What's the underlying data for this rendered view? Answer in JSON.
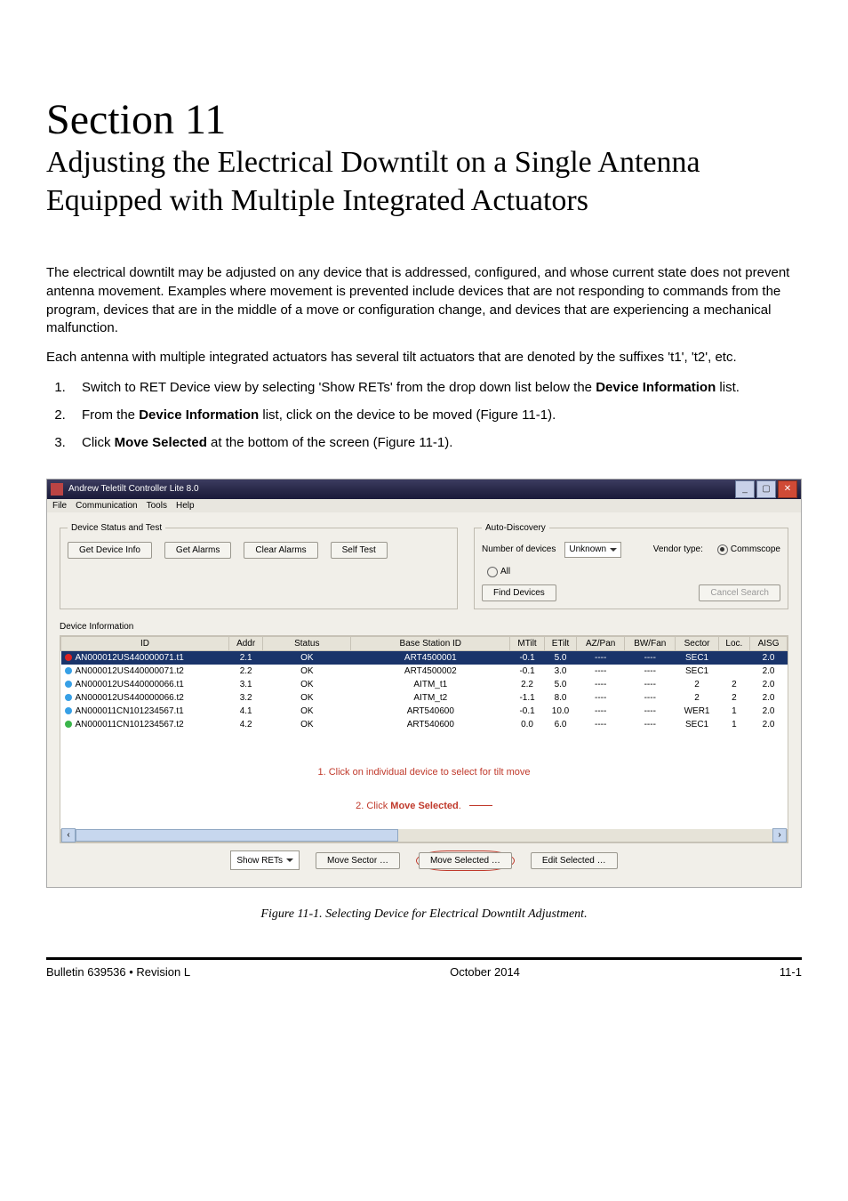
{
  "document": {
    "section_label": "Section 11",
    "section_title": "Adjusting the Electrical Downtilt on a Single Antenna Equipped with Multiple Integrated Actuators",
    "intro_p1": "The electrical downtilt may be adjusted on any device that is addressed, configured, and whose current state does not prevent antenna movement. Examples where movement is prevented include devices that are not responding to commands from the program, devices that are in the middle of a move or configuration change, and devices that are experiencing a mechanical malfunction.",
    "intro_p2": "Each antenna with multiple integrated actuators has several tilt actuators that are denoted by the suffixes 't1', 't2', etc.",
    "step1_pre": "Switch to RET Device view by selecting 'Show RETs' from the drop down list below the ",
    "step1_bold": "Device Information",
    "step1_post": " list.",
    "step2_pre": "From the ",
    "step2_bold": "Device Information",
    "step2_post": " list, click on the device to be moved (Figure 11-1).",
    "step3_pre": "Click ",
    "step3_bold": "Move Selected",
    "step3_post": " at the bottom of the screen (Figure 11-1).",
    "figure_caption": "Figure 11-1. Selecting Device for Electrical Downtilt Adjustment.",
    "footer_left": "Bulletin 639536  •  Revision L",
    "footer_center": "October 2014",
    "footer_right": "11-1"
  },
  "app": {
    "title": "Andrew Teletilt Controller Lite 8.0",
    "menu": {
      "file": "File",
      "comm": "Communication",
      "tools": "Tools",
      "help": "Help"
    },
    "device_status_legend": "Device Status and Test",
    "buttons": {
      "get_device_info": "Get Device Info",
      "get_alarms": "Get Alarms",
      "clear_alarms": "Clear Alarms",
      "self_test": "Self Test",
      "find_devices": "Find Devices",
      "cancel_search": "Cancel Search",
      "move_sector": "Move Sector …",
      "move_selected": "Move Selected …",
      "edit_selected": "Edit Selected …"
    },
    "auto_discovery": {
      "legend": "Auto-Discovery",
      "num_label": "Number of devices",
      "num_value": "Unknown",
      "vendor_label": "Vendor type:",
      "commscope": "Commscope",
      "all": "All"
    },
    "device_info_label": "Device Information",
    "headers": {
      "id": "ID",
      "addr": "Addr",
      "status": "Status",
      "base": "Base Station ID",
      "mtilt": "MTilt",
      "etilt": "ETilt",
      "azpan": "AZ/Pan",
      "bwfan": "BW/Fan",
      "sector": "Sector",
      "loc": "Loc.",
      "aisg": "AISG"
    },
    "rows": [
      {
        "sel": true,
        "dot": "red",
        "id": "AN000012US440000071.t1",
        "addr": "2.1",
        "status": "OK",
        "base": "ART4500001",
        "mtilt": "-0.1",
        "etilt": "5.0",
        "azpan": "----",
        "bwfan": "----",
        "sector": "SEC1",
        "loc": "",
        "aisg": "2.0"
      },
      {
        "sel": false,
        "dot": "blue",
        "id": "AN000012US440000071.t2",
        "addr": "2.2",
        "status": "OK",
        "base": "ART4500002",
        "mtilt": "-0.1",
        "etilt": "3.0",
        "azpan": "----",
        "bwfan": "----",
        "sector": "SEC1",
        "loc": "",
        "aisg": "2.0"
      },
      {
        "sel": false,
        "dot": "blue",
        "id": "AN000012US440000066.t1",
        "addr": "3.1",
        "status": "OK",
        "base": "AITM_t1",
        "mtilt": "2.2",
        "etilt": "5.0",
        "azpan": "----",
        "bwfan": "----",
        "sector": "2",
        "loc": "2",
        "aisg": "2.0"
      },
      {
        "sel": false,
        "dot": "blue",
        "id": "AN000012US440000066.t2",
        "addr": "3.2",
        "status": "OK",
        "base": "AITM_t2",
        "mtilt": "-1.1",
        "etilt": "8.0",
        "azpan": "----",
        "bwfan": "----",
        "sector": "2",
        "loc": "2",
        "aisg": "2.0"
      },
      {
        "sel": false,
        "dot": "blue",
        "id": "AN000011CN101234567.t1",
        "addr": "4.1",
        "status": "OK",
        "base": "ART540600",
        "mtilt": "-0.1",
        "etilt": "10.0",
        "azpan": "----",
        "bwfan": "----",
        "sector": "WER1",
        "loc": "1",
        "aisg": "2.0"
      },
      {
        "sel": false,
        "dot": "green",
        "id": "AN000011CN101234567.t2",
        "addr": "4.2",
        "status": "OK",
        "base": "ART540600",
        "mtilt": "0.0",
        "etilt": "6.0",
        "azpan": "----",
        "bwfan": "----",
        "sector": "SEC1",
        "loc": "1",
        "aisg": "2.0"
      }
    ],
    "callout1": "1. Click on individual device to select for tilt move",
    "callout2_pre": "2. Click ",
    "callout2_bold": "Move Selected",
    "callout2_post": ".",
    "view_select": "Show RETs"
  }
}
